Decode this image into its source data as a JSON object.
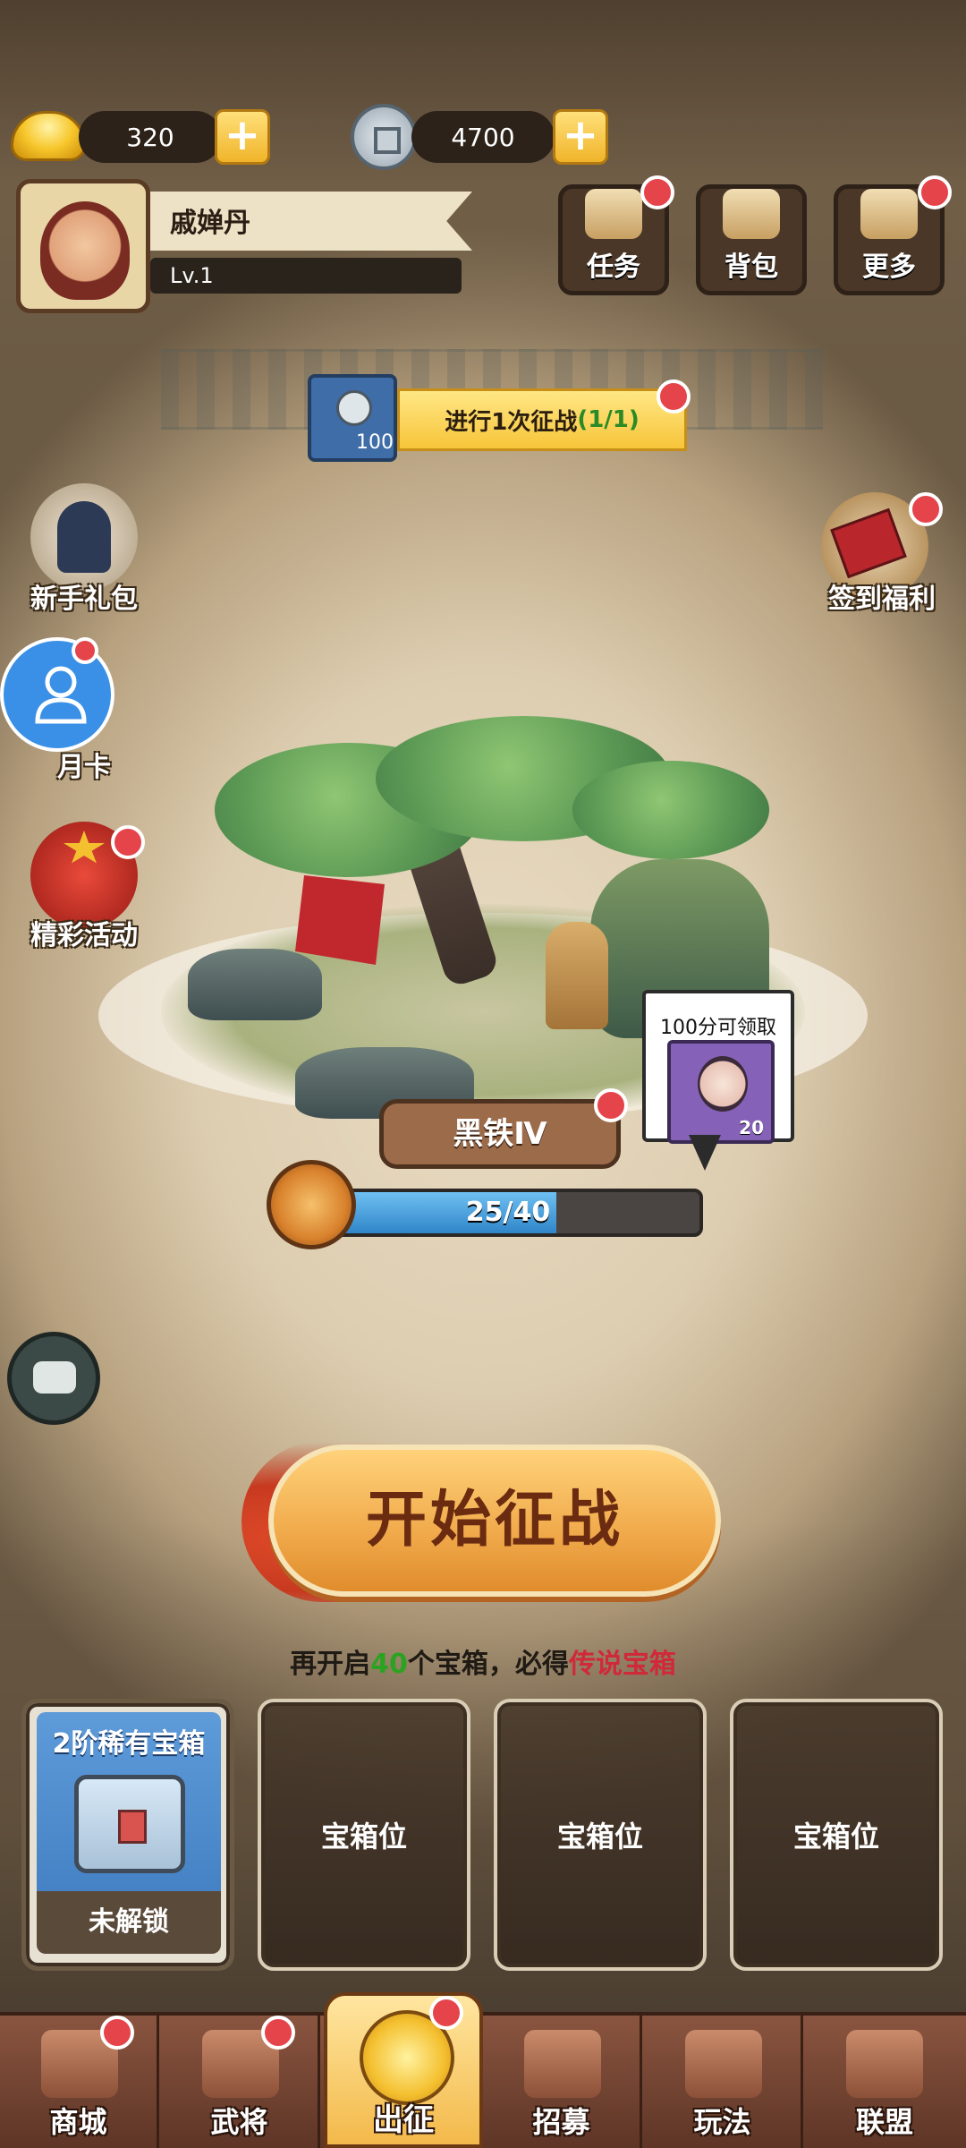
{
  "currency": {
    "gold": {
      "icon": "gold-ingot-icon",
      "value": "320"
    },
    "copper": {
      "icon": "copper-coin-icon",
      "value": "4700"
    }
  },
  "player": {
    "name": "戚婵丹",
    "level": "Lv.1"
  },
  "top_buttons": [
    {
      "label": "任务",
      "icon": "scroll-icon"
    },
    {
      "label": "背包",
      "icon": "bag-icon"
    },
    {
      "label": "更多",
      "icon": "list-icon"
    }
  ],
  "quest": {
    "reward": "100",
    "text": "进行1次征战",
    "progress": "(1/1)"
  },
  "side_left": [
    {
      "label": "新手礼包",
      "icon": "warrior-icon"
    },
    {
      "label": "月卡",
      "icon": "user-icon"
    },
    {
      "label": "精彩活动",
      "icon": "gift-bag-icon"
    }
  ],
  "side_right": {
    "label": "签到福利",
    "icon": "signin-chest-icon"
  },
  "rank": {
    "name": "黑铁Ⅳ",
    "xp_text": "25/40",
    "xp_current": 25,
    "xp_max": 40
  },
  "reward_bubble": {
    "title": "100分可领取",
    "count": "20"
  },
  "start_button": "开始征战",
  "chest_tip": {
    "prefix": "再开启",
    "num": "40",
    "mid": "个宝箱，必得",
    "highlight": "传说宝箱"
  },
  "chest_slots": {
    "first": {
      "title": "2阶稀有宝箱",
      "status": "未解锁"
    },
    "empty_label": "宝箱位"
  },
  "nav": [
    {
      "label": "商城",
      "icon": "shop-icon"
    },
    {
      "label": "武将",
      "icon": "helmet-icon"
    },
    {
      "label": "出征",
      "icon": "gold-medal-icon"
    },
    {
      "label": "招募",
      "icon": "recruit-scroll-icon"
    },
    {
      "label": "玩法",
      "icon": "pavilion-icon"
    },
    {
      "label": "联盟",
      "icon": "alliance-flag-icon"
    }
  ],
  "colors": {
    "accent_red": "#e5444b",
    "progress_blue": "#2f85c8",
    "green_text": "#2ca320",
    "legend_red": "#d0293a"
  }
}
